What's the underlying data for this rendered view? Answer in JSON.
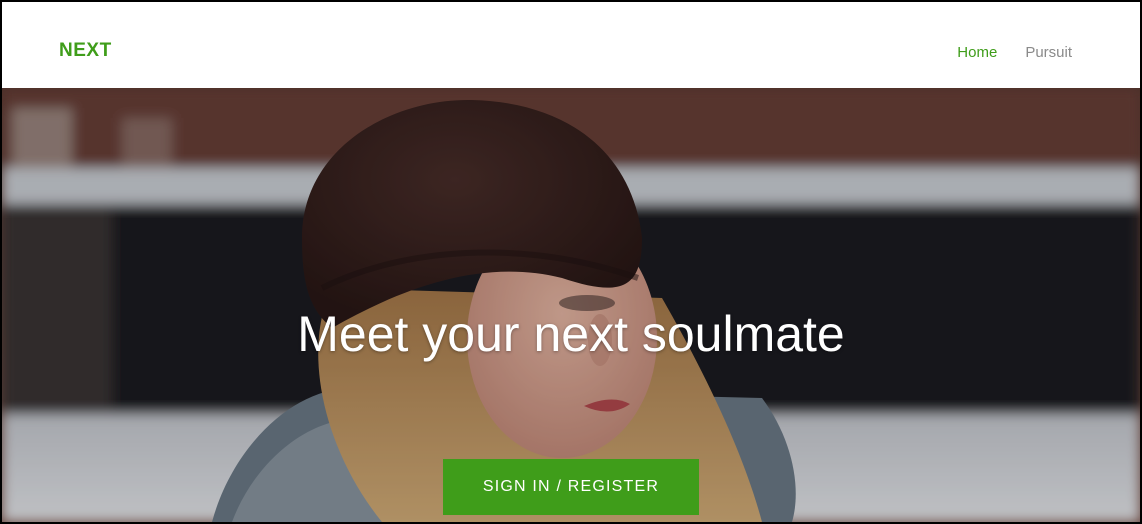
{
  "colors": {
    "brand": "#3f9d1a",
    "nav_inactive": "#8a8a8a",
    "hero_text": "#ffffff"
  },
  "navbar": {
    "brand": "NEXT",
    "links": [
      {
        "label": "Home",
        "active": true
      },
      {
        "label": "Pursuit",
        "active": false
      }
    ]
  },
  "hero": {
    "image_icon": "portrait-photo",
    "title": "Meet your next soulmate",
    "cta_label": "SIGN IN / REGISTER"
  }
}
